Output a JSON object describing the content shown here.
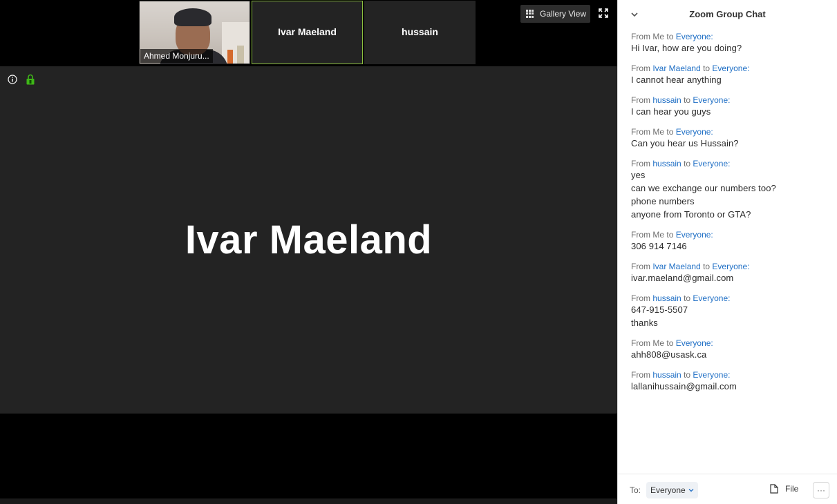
{
  "gallery": {
    "thumbnails": [
      {
        "name": "Ahmed Monjuru...",
        "has_video": true
      },
      {
        "name": "Ivar Maeland",
        "active": true
      },
      {
        "name": "hussain"
      }
    ],
    "view_button_label": "Gallery View"
  },
  "main_video": {
    "speaker_name": "Ivar Maeland"
  },
  "chat": {
    "title": "Zoom Group Chat",
    "messages": [
      {
        "from_prefix": "From",
        "sender": "Me",
        "to_word": "to",
        "recipient": "Everyone:",
        "lines": [
          "Hi Ivar, how are you doing?"
        ]
      },
      {
        "from_prefix": "From",
        "sender": "Ivar Maeland",
        "to_word": "to",
        "recipient": "Everyone:",
        "lines": [
          "I cannot hear anything"
        ]
      },
      {
        "from_prefix": "From",
        "sender": "hussain",
        "to_word": "to",
        "recipient": "Everyone:",
        "lines": [
          "I can hear you guys"
        ]
      },
      {
        "from_prefix": "From",
        "sender": "Me",
        "to_word": "to",
        "recipient": "Everyone:",
        "lines": [
          "Can you hear us Hussain?"
        ]
      },
      {
        "from_prefix": "From",
        "sender": "hussain",
        "to_word": "to",
        "recipient": "Everyone:",
        "lines": [
          "yes",
          "can we exchange our numbers too?",
          "phone numbers",
          "anyone from Toronto or GTA?"
        ]
      },
      {
        "from_prefix": "From",
        "sender": "Me",
        "to_word": "to",
        "recipient": "Everyone:",
        "lines": [
          "306 914 7146"
        ]
      },
      {
        "from_prefix": "From",
        "sender": "Ivar Maeland",
        "to_word": "to",
        "recipient": "Everyone:",
        "lines": [
          "ivar.maeland@gmail.com"
        ]
      },
      {
        "from_prefix": "From",
        "sender": "hussain",
        "to_word": "to",
        "recipient": "Everyone:",
        "lines": [
          "647-915-5507",
          "thanks"
        ]
      },
      {
        "from_prefix": "From",
        "sender": "Me",
        "to_word": "to",
        "recipient": "Everyone:",
        "lines": [
          "ahh808@usask.ca"
        ]
      },
      {
        "from_prefix": "From",
        "sender": "hussain",
        "to_word": "to",
        "recipient": "Everyone:",
        "lines": [
          "lallanihussain@gmail.com"
        ]
      }
    ],
    "footer": {
      "to_label": "To:",
      "to_value": "Everyone",
      "file_label": "File",
      "more_label": "···"
    }
  },
  "colors": {
    "accent_link": "#1f6fc5",
    "active_speaker_border": "#8bbf3f",
    "encryption_lock": "#3fb618"
  }
}
